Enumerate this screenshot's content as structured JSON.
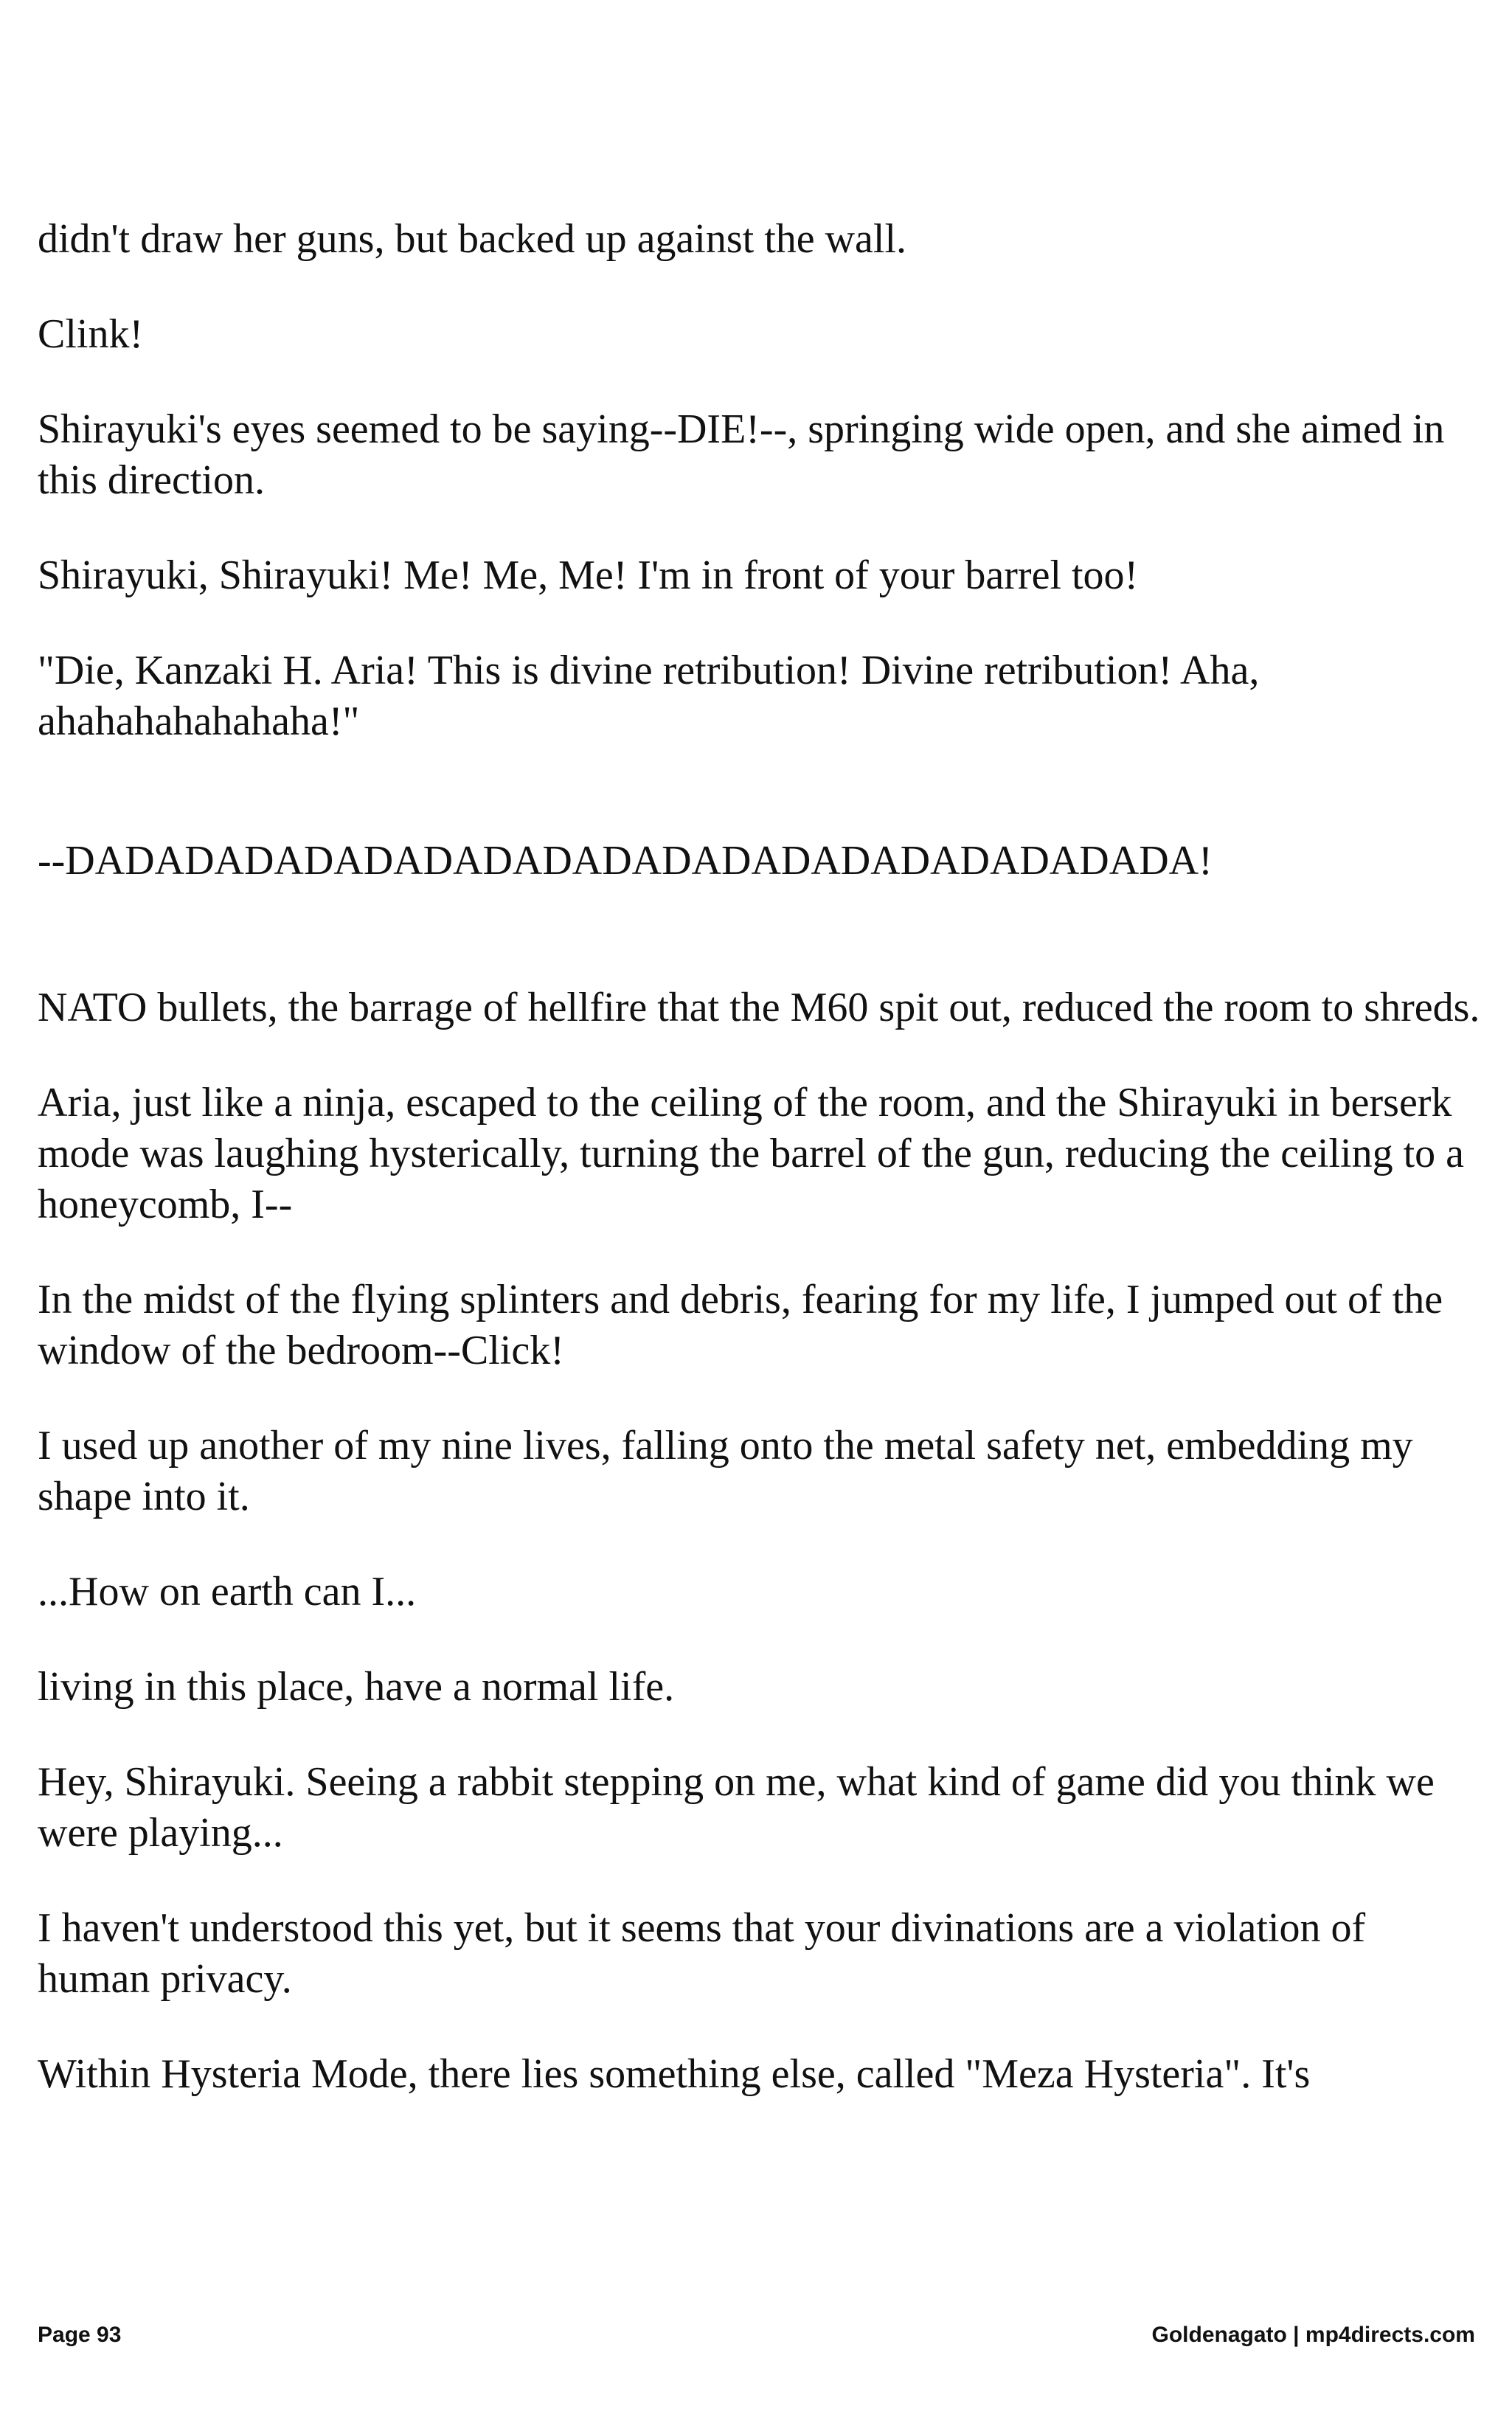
{
  "document": {
    "paragraphs": [
      "didn't draw her guns, but backed up against the wall.",
      "Clink!",
      "Shirayuki's eyes seemed to be saying--DIE!--, springing wide open, and she aimed in this direction.",
      "Shirayuki, Shirayuki! Me! Me, Me! I'm in front of your barrel too!",
      "\"Die, Kanzaki H. Aria! This is divine retribution! Divine retribution! Aha, ahahahahahahaha!\"",
      "--DADADADADADADADADADADADADADADADADADADA!",
      "NATO bullets, the barrage of hellfire that the M60 spit out, reduced the room to shreds.",
      "Aria, just like a ninja, escaped to the ceiling of the room, and the Shirayuki in berserk mode was laughing hysterically, turning the barrel of the gun, reducing the ceiling to a honeycomb, I--",
      "In the midst of the flying splinters and debris, fearing for my life, I jumped out of the window of the bedroom--Click!",
      "I used up another of my nine lives, falling onto the metal safety net, embedding my shape into it.",
      "...How on earth can I...",
      "living in this place, have a normal life.",
      "Hey, Shirayuki. Seeing a rabbit stepping on me, what kind of game did you think we were playing...",
      "I haven't understood this yet, but it seems that your divinations are a violation of human privacy.",
      "Within Hysteria Mode, there lies something else, called \"Meza Hysteria\". It's"
    ]
  },
  "footer": {
    "page_label": "Page 93",
    "credit": "Goldenagato | mp4directs.com"
  }
}
